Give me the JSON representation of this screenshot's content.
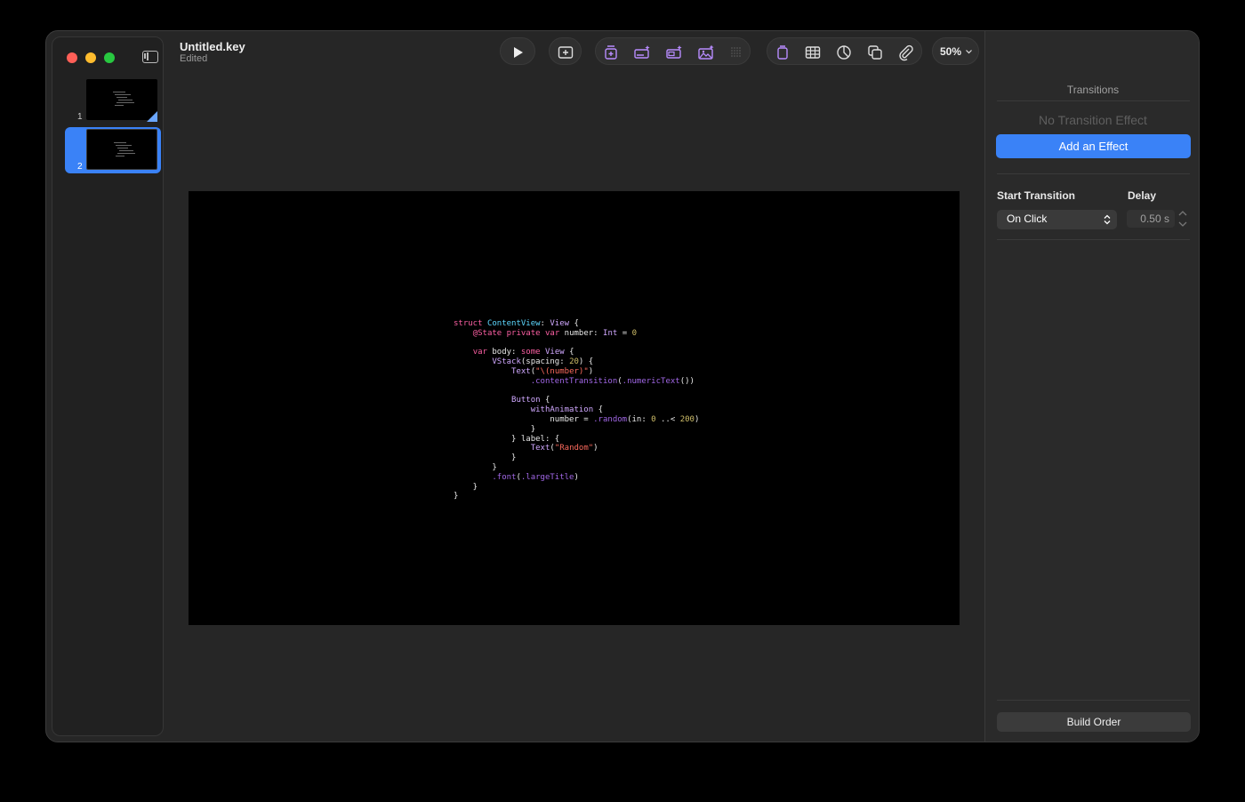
{
  "document": {
    "title": "Untitled.key",
    "status": "Edited"
  },
  "slides": [
    {
      "number": "1"
    },
    {
      "number": "2"
    }
  ],
  "toolbar": {
    "play_icon": "play-icon",
    "add_slide_icon": "add-slide-icon",
    "insert_icons": [
      "text-box-ai-icon",
      "banner-ai-icon",
      "card-ai-icon",
      "image-ai-icon",
      "grid-dots-icon"
    ],
    "object_icons": [
      "text-icon",
      "table-icon",
      "chart-icon",
      "shape-icon",
      "media-icon"
    ],
    "zoom": "50%",
    "right_icons": [
      "comment-icon",
      "share-icon",
      "format-brush-icon",
      "animate-icon",
      "document-icon"
    ]
  },
  "code_lines": [
    "struct ContentView: View {",
    "    @State private var number: Int = 0",
    "",
    "    var body: some View {",
    "        VStack(spacing: 20) {",
    "            Text(\"\\(number)\")",
    "                .contentTransition(.numericText())",
    "",
    "            Button {",
    "                withAnimation {",
    "                    number = .random(in: 0 ..< 200)",
    "                }",
    "            } label: {",
    "                Text(\"Random\")",
    "            }",
    "        }",
    "        .font(.largeTitle)",
    "    }",
    "}"
  ],
  "inspector": {
    "title": "Transitions",
    "no_effect": "No Transition Effect",
    "add_effect": "Add an Effect",
    "start_transition_label": "Start Transition",
    "start_transition_value": "On Click",
    "delay_label": "Delay",
    "delay_value": "0.50 s",
    "build_order": "Build Order"
  },
  "colors": {
    "accent": "#3a82f7",
    "close": "#ff5f57",
    "minimize": "#febc2e",
    "maximize": "#28c840",
    "toolbar_purple": "#b88cff"
  }
}
